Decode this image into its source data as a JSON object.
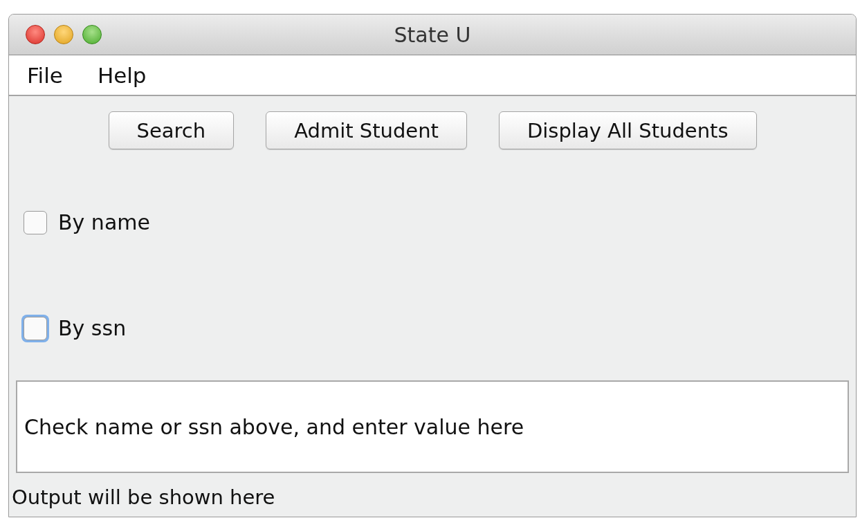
{
  "window": {
    "title": "State U"
  },
  "menu": [
    {
      "label": "File"
    },
    {
      "label": "Help"
    }
  ],
  "buttons": [
    {
      "label": "Search"
    },
    {
      "label": "Admit Student"
    },
    {
      "label": "Display All Students"
    }
  ],
  "options": [
    {
      "label": "By name",
      "checked": false,
      "focused": false
    },
    {
      "label": "By ssn",
      "checked": false,
      "focused": true
    }
  ],
  "input": {
    "value": "Check name or ssn above, and enter value here"
  },
  "output": "Output will be shown here"
}
